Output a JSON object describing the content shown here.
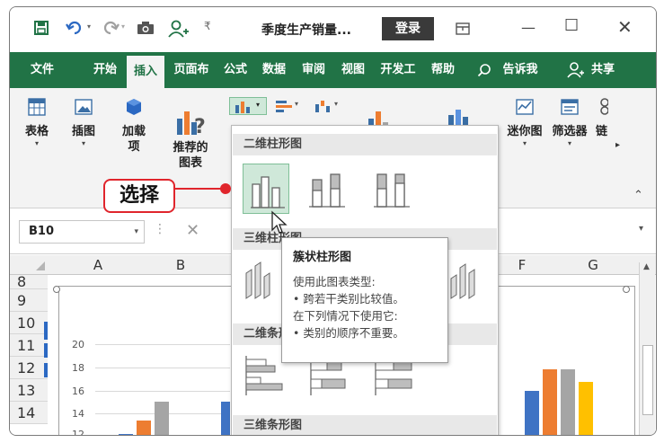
{
  "titlebar": {
    "title": "季度生产销量...",
    "login_label": "登录"
  },
  "ribbon_tabs": [
    "文件",
    "开始",
    "插入",
    "页面布",
    "公式",
    "数据",
    "审阅",
    "视图",
    "开发工",
    "帮助"
  ],
  "tell_me": "告诉我",
  "share_label": "共享",
  "ribbon": {
    "table_label": "表格",
    "illustrations_label": "插图",
    "addins_label_1": "加载",
    "addins_label_2": "项",
    "recommended_label_1": "推荐的",
    "recommended_label_2": "图表",
    "sparkline_label": "迷你图",
    "filter_label": "筛选器",
    "link_label": "链"
  },
  "namebox": {
    "value": "B10"
  },
  "columns": [
    "A",
    "B",
    "F",
    "G"
  ],
  "rows": [
    "8",
    "9",
    "10",
    "11",
    "12",
    "13",
    "14"
  ],
  "chart_axis": [
    "20",
    "18",
    "16",
    "14",
    "12"
  ],
  "dropdown": {
    "section_2d_column": "二维柱形图",
    "section_3d_column": "三维柱形图",
    "section_2d_bar": "二维条形图",
    "section_3d_bar": "三维条形图"
  },
  "tooltip": {
    "title": "簇状柱形图",
    "line1": "使用此图表类型:",
    "line2": "• 跨若干类别比较值。",
    "line3": "在下列情况下使用它:",
    "line4": "• 类别的顺序不重要。"
  },
  "callout": {
    "label": "选择"
  },
  "colors": {
    "excel_green": "#217346",
    "callout_red": "#e0252c",
    "selected_fill": "#cfe8d9",
    "series_blue": "#3f73c4",
    "series_orange": "#ed7d31",
    "series_gray": "#a5a5a5",
    "series_yellow": "#ffc000"
  }
}
